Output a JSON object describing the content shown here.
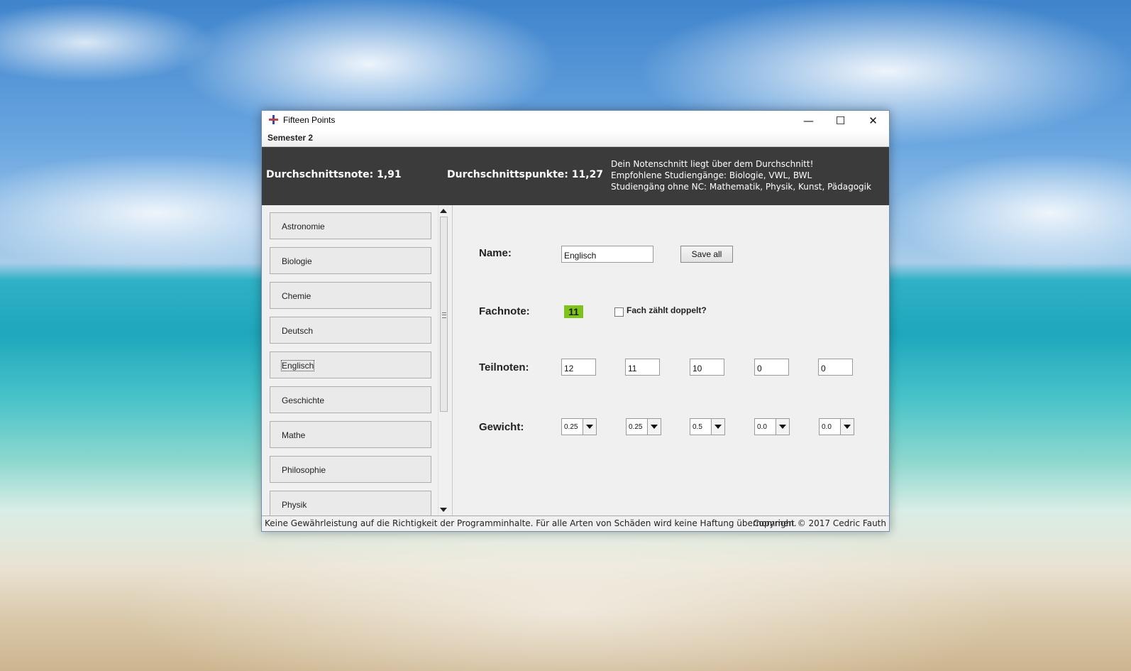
{
  "window": {
    "title": "Fifteen Points",
    "minimize_glyph": "—",
    "maximize_glyph": "☐",
    "close_glyph": "✕"
  },
  "menu": {
    "semester_label": "Semester 2"
  },
  "header": {
    "average_grade": "Durchschnittsnote: 1,91",
    "average_points": "Durchschnittspunkte: 11,27",
    "info": [
      "Dein Notenschnitt liegt über dem Durchschnitt!",
      "Empfohlene Studiengänge: Biologie, VWL, BWL",
      "Studiengäng ohne NC: Mathematik, Physik, Kunst, Pädagogik"
    ]
  },
  "subjects": [
    {
      "label": "Astronomie"
    },
    {
      "label": "Biologie"
    },
    {
      "label": "Chemie"
    },
    {
      "label": "Deutsch"
    },
    {
      "label": "Englisch",
      "selected": true
    },
    {
      "label": "Geschichte"
    },
    {
      "label": "Mathe"
    },
    {
      "label": "Philosophie"
    },
    {
      "label": "Physik"
    }
  ],
  "detail": {
    "name_label": "Name:",
    "name_value": "Englisch",
    "save_label": "Save all",
    "grade_label": "Fachnote:",
    "grade_value": "11",
    "grade_color": "#7cc41a",
    "double_label": "Fach zählt doppelt?",
    "double_checked": false,
    "partial_label": "Teilnoten:",
    "partial_grades": [
      "12",
      "11",
      "10",
      "0",
      "0"
    ],
    "weight_label": "Gewicht:",
    "weights": [
      "0.25",
      "0.25",
      "0.5",
      "0.0",
      "0.0"
    ]
  },
  "status": {
    "disclaimer": "Keine Gewährleistung auf die Richtigkeit der Programminhalte. Für alle Arten von Schäden wird keine Haftung übernommen.",
    "copyright": "Copyright © 2017 Cedric Fauth"
  },
  "colors": {
    "header_bg": "#3b3b3b",
    "window_bg": "#f0f0f0",
    "grade_badge": "#7cc41a"
  }
}
